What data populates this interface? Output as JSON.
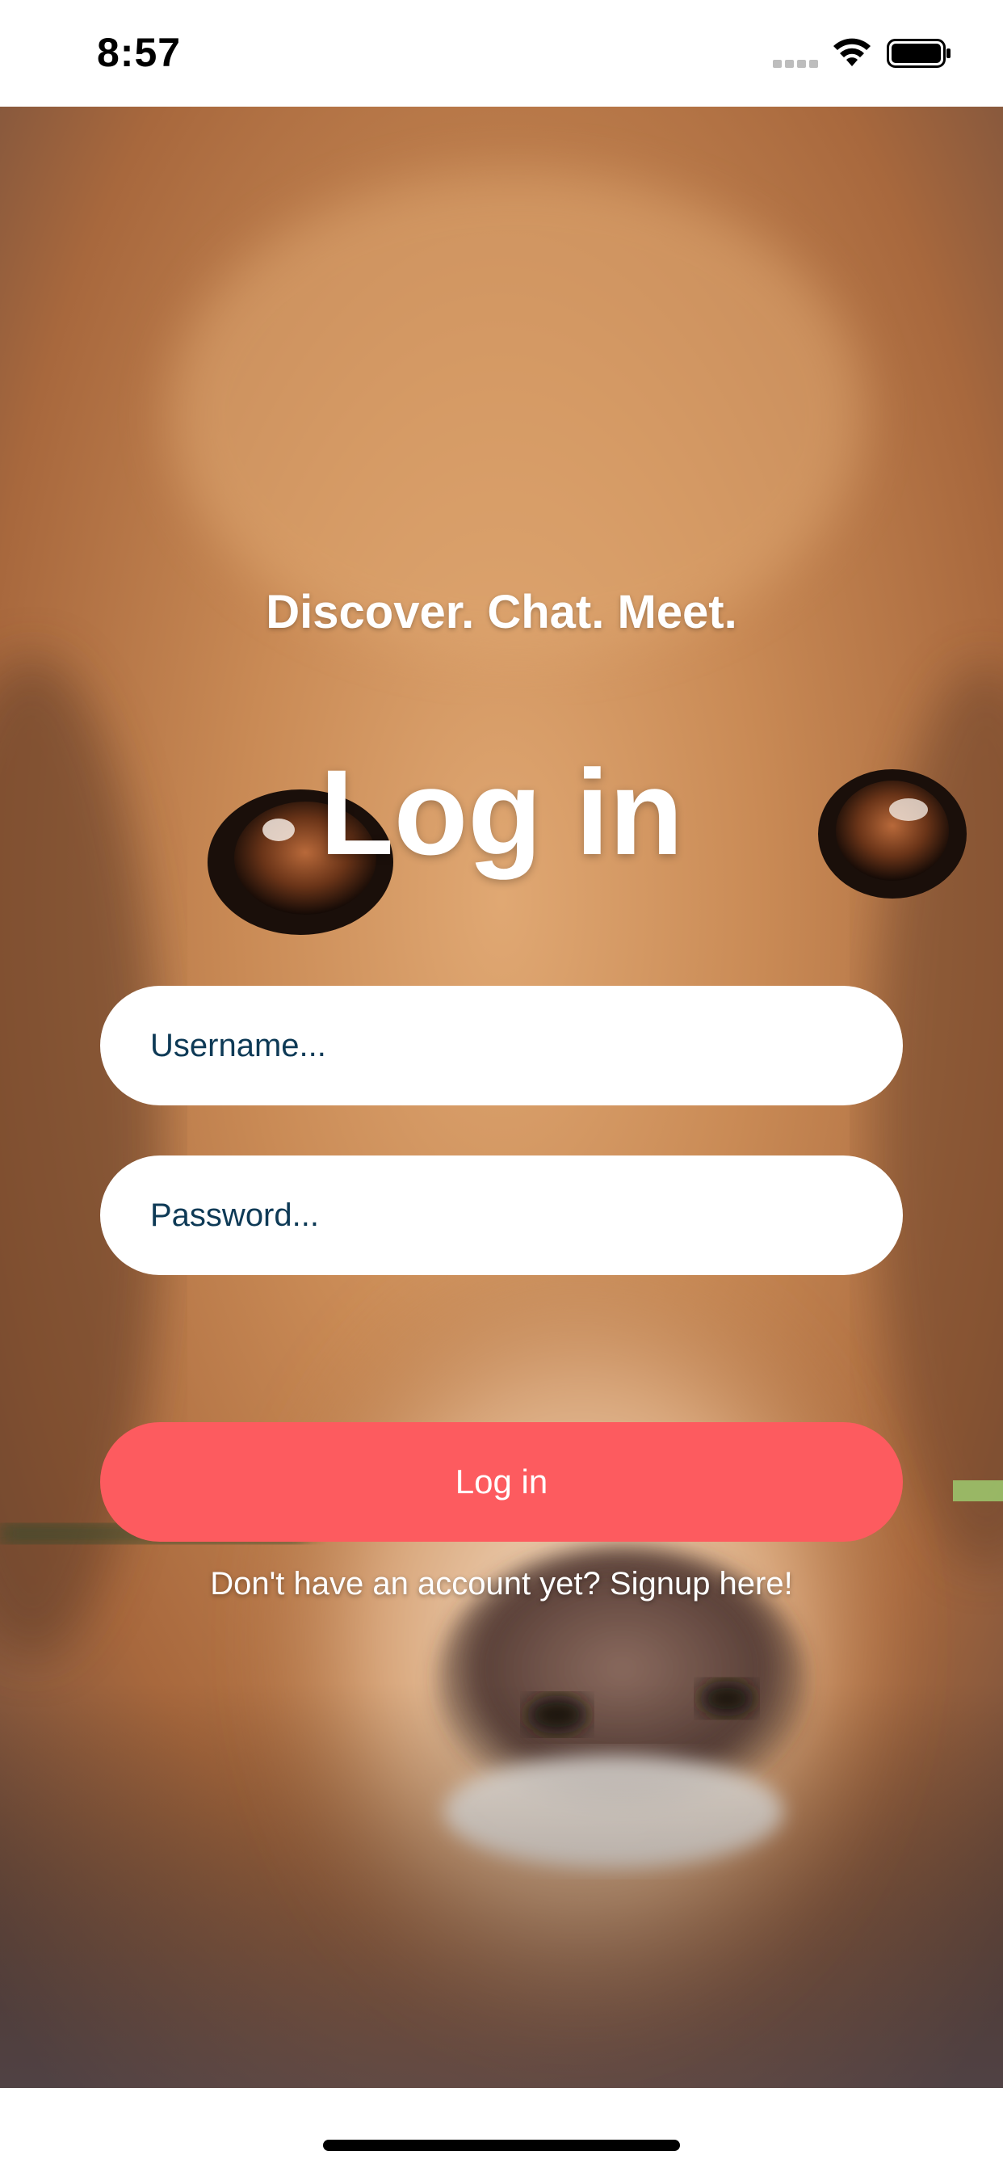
{
  "status_bar": {
    "time": "8:57",
    "icons": [
      "signal-icon",
      "wifi-icon",
      "battery-icon"
    ]
  },
  "background": {
    "description_icon": "dog-photo"
  },
  "login": {
    "tagline": "Discover. Chat. Meet.",
    "title": "Log in",
    "username_placeholder": "Username...",
    "password_placeholder": "Password...",
    "button_label": "Log in",
    "signup_text": "Don't have an account yet? Signup here!"
  },
  "colors": {
    "accent": "#fd5b5f",
    "input_text": "#0e3a56",
    "input_bg": "#ffffff",
    "text_on_photo": "#ffffff"
  }
}
